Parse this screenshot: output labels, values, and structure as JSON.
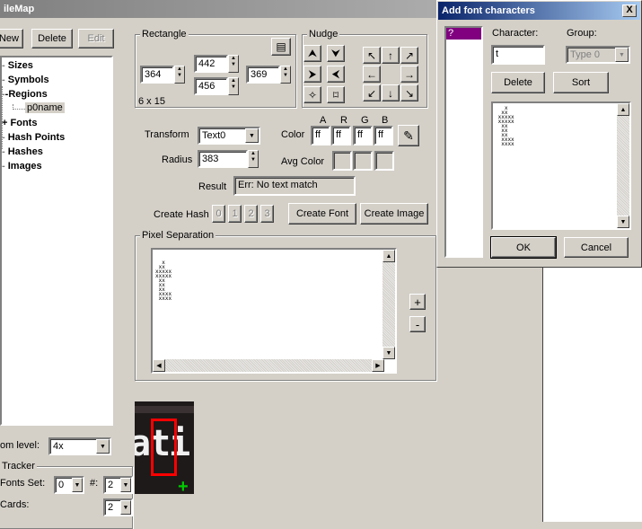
{
  "main_window": {
    "title": "ileMap",
    "toolbar": {
      "new": "New",
      "delete": "Delete",
      "edit": "Edit"
    },
    "tree": [
      {
        "label": "Sizes",
        "expander": ""
      },
      {
        "label": "Symbols",
        "expander": ""
      },
      {
        "label": "Regions",
        "expander": "-"
      },
      {
        "label": "p0name",
        "child": true
      },
      {
        "label": "Fonts",
        "expander": "+"
      },
      {
        "label": "Hash Points",
        "expander": ""
      },
      {
        "label": "Hashes",
        "expander": ""
      },
      {
        "label": "Images",
        "expander": ""
      }
    ],
    "zoom": {
      "label": "om level:",
      "value": "4x"
    },
    "tracker": {
      "label": "Tracker",
      "fonts_set_label": "Fonts Set:",
      "fonts_set_value": "0",
      "hash_label": "#:",
      "hash_value": "2",
      "cards_label": "Cards:",
      "cards_value": "2"
    },
    "rectangle": {
      "label": "Rectangle",
      "x": "364",
      "y_top": "442",
      "y_bottom": "456",
      "w": "369",
      "size_text": "6 x 15"
    },
    "nudge": {
      "label": "Nudge",
      "arrows": [
        "↖",
        "↑",
        "↗",
        "←",
        "→",
        "↙",
        "↓",
        "↘"
      ]
    },
    "transform": {
      "label": "Transform",
      "value": "Text0"
    },
    "radius": {
      "label": "Radius",
      "value": "383"
    },
    "color": {
      "label": "Color",
      "headers": [
        "A",
        "R",
        "G",
        "B"
      ],
      "values": [
        "ff",
        "ff",
        "ff",
        "ff"
      ]
    },
    "avg_color_label": "Avg Color",
    "result": {
      "label": "Result",
      "value": "Err: No text match"
    },
    "create_hash": {
      "label": "Create Hash",
      "buttons": [
        "0",
        "1",
        "2",
        "3"
      ]
    },
    "create_font": "Create Font",
    "create_image": "Create Image",
    "pixel_separation": {
      "label": "Pixel Separation",
      "plus": "+",
      "minus": "-",
      "glyph": "  x\n xx\nxxxxx\nxxxxx\n xx\n xx\n xx\n xxxx\n xxxx"
    },
    "preview_text": "ati"
  },
  "dialog": {
    "title": "Add font characters",
    "close": "X",
    "list_items": [
      "?"
    ],
    "character_label": "Character:",
    "character_value": "t",
    "group_label": "Group:",
    "group_value": "Type 0",
    "delete": "Delete",
    "sort": "Sort",
    "glyph": "   x\n  xx\n xxxxx\n xxxxx\n  xx\n  xx\n  xx\n  xxxx\n  xxxx",
    "ok": "OK",
    "cancel": "Cancel"
  },
  "colors": {
    "dialog_title_bg": "#0a246a",
    "main_title_bg": "#808080",
    "list_selected": "#800080",
    "preview_highlight": "#ff0000",
    "preview_marker": "#00cc00"
  }
}
